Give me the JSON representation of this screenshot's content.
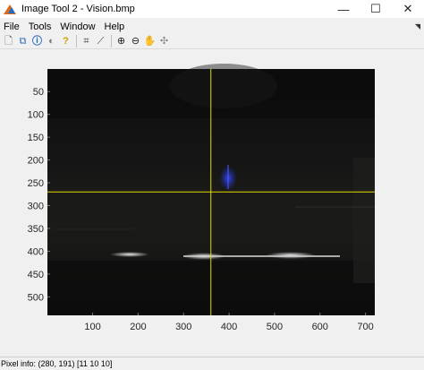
{
  "window": {
    "title": "Image Tool 2 - Vision.bmp",
    "minimize_glyph": "—",
    "maximize_glyph": "☐",
    "close_glyph": "✕"
  },
  "menu": {
    "items": [
      "File",
      "Tools",
      "Window",
      "Help"
    ],
    "grip_glyph": "◥"
  },
  "toolbar": {
    "buttons": [
      {
        "name": "new-figure-icon",
        "glyph": "🗋"
      },
      {
        "name": "export-icon",
        "glyph": "⧉"
      },
      {
        "name": "image-info-icon",
        "glyph": "ⓘ"
      },
      {
        "name": "contrast-icon",
        "glyph": "◐"
      },
      {
        "name": "help-icon",
        "glyph": "?"
      },
      {
        "name": "crop-icon",
        "glyph": "⌗"
      },
      {
        "name": "measure-distance-icon",
        "glyph": "⟋"
      },
      {
        "name": "zoom-in-icon",
        "glyph": "⊕"
      },
      {
        "name": "zoom-out-icon",
        "glyph": "⊖"
      },
      {
        "name": "pan-hand-icon",
        "glyph": "✋"
      },
      {
        "name": "pixel-region-icon",
        "glyph": "✣"
      }
    ]
  },
  "axes": {
    "x_ticks": [
      "100",
      "200",
      "300",
      "400",
      "500",
      "600",
      "700"
    ],
    "y_ticks": [
      "50",
      "100",
      "150",
      "200",
      "250",
      "300",
      "350",
      "400",
      "450",
      "500"
    ],
    "x_range": [
      0.5,
      720.5
    ],
    "y_range": [
      0.5,
      540.5
    ],
    "crosshair_color": "#e8d800",
    "crosshair_x": 360,
    "crosshair_y": 270
  },
  "status": {
    "text": "Pixel info: (280, 191)  [11 10 10]"
  }
}
